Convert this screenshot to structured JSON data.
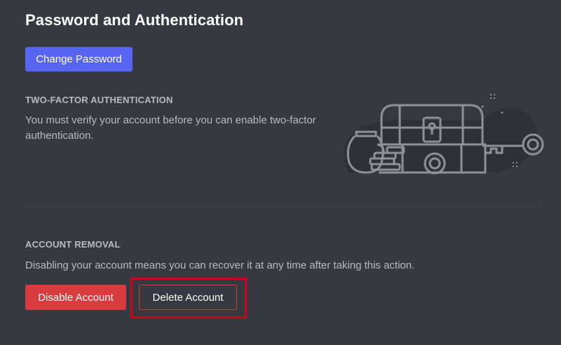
{
  "page": {
    "title": "Password and Authentication"
  },
  "password": {
    "change_label": "Change Password"
  },
  "two_factor": {
    "heading": "TWO-FACTOR AUTHENTICATION",
    "description_line1": "You must verify your account before you can enable two-factor",
    "description_line2": "authentication."
  },
  "account_removal": {
    "heading": "ACCOUNT REMOVAL",
    "description": "Disabling your account means you can recover it at any time after taking this action.",
    "disable_label": "Disable Account",
    "delete_label": "Delete Account"
  },
  "colors": {
    "background": "#36393f",
    "primary": "#5865f2",
    "danger": "#d83c3e",
    "highlight": "#d0021b"
  },
  "icons": [
    "treasure-chest-illustration",
    "key-icon",
    "padlock-icon"
  ]
}
